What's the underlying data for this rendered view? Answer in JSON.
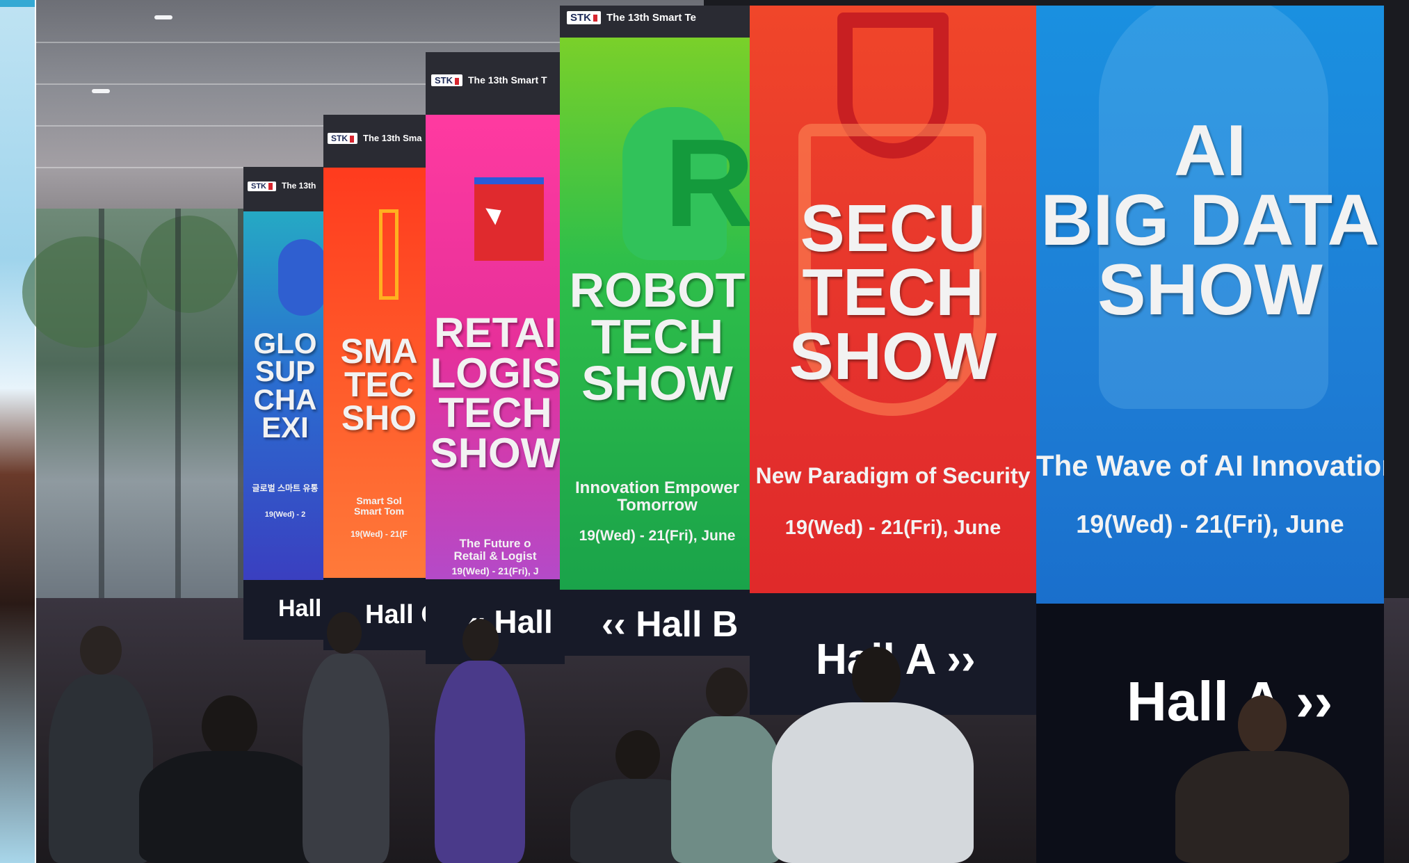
{
  "colors": {
    "global_panel": "#2a52c8",
    "smart_panel": "#ff5a2a",
    "retail_panel": "#e0369e",
    "robot_panel": "#22b04a",
    "secu_panel": "#e5322d",
    "ai_panel": "#1e7fd6",
    "hall_footer": "#171a28"
  },
  "panels": [
    {
      "id": "global",
      "logo": "STK",
      "header": "The 13th",
      "title": "GLO\nSUP\nCHA\nEXI",
      "tagline": "글로벌 스마트 유통",
      "date": "19(Wed) - 2",
      "hall": "Hall"
    },
    {
      "id": "smart",
      "logo": "STK",
      "header": "The 13th Sma",
      "title": "SMA\nTEC\nSHO",
      "tagline": "Smart Sol\nSmart Tom",
      "date": "19(Wed) - 21(F",
      "hall": "Hall C"
    },
    {
      "id": "retail",
      "logo": "STK",
      "header": "The 13th Smart T",
      "title": "RETAI\nLOGIS\nTECH\nSHOW",
      "tagline": "The Future o\nRetail & Logist",
      "date": "19(Wed) - 21(Fri), J",
      "hall": "« Hall"
    },
    {
      "id": "robot",
      "logo": "STK",
      "header": "The 13th Smart Te",
      "title": "ROBOT\nTECH\nSHOW",
      "tagline": "Innovation Empower\nTomorrow",
      "date": "19(Wed) - 21(Fri), June",
      "hall": "‹‹ Hall B"
    },
    {
      "id": "secu",
      "logo": "",
      "header": "",
      "title": "SECU\nTECH\nSHOW",
      "tagline": "New Paradigm of Security",
      "date": "19(Wed) - 21(Fri), June",
      "hall": "Hall A ››"
    },
    {
      "id": "ai",
      "logo": "",
      "header": "",
      "title": "AI\nBIG DATA\nSHOW",
      "tagline": "The Wave of AI Innovation",
      "date": "19(Wed) - 21(Fri), June",
      "hall": "Hall A ››"
    }
  ]
}
